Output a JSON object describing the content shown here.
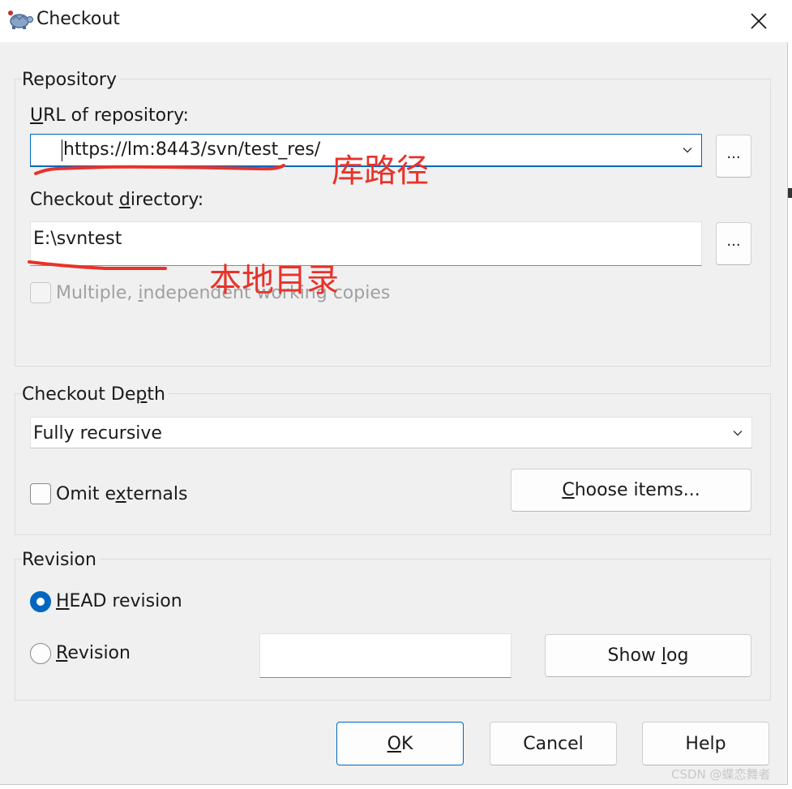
{
  "window": {
    "title": "Checkout",
    "app_icon": "tortoise-icon",
    "close_icon": "close-icon"
  },
  "repository": {
    "group_label": "Repository",
    "url_label_accel": "U",
    "url_label_rest": "RL of repository:",
    "url_value": "https://lm:8443/svn/test_res/",
    "url_browse_label": "...",
    "dir_label_pre": "Checkout ",
    "dir_label_accel": "d",
    "dir_label_post": "irectory:",
    "dir_value": "E:\\svntest",
    "dir_browse_label": "...",
    "multiple_label_pre": "Multiple, ",
    "multiple_label_accel": "i",
    "multiple_label_post": "ndependent working copies",
    "multiple_checked": false,
    "multiple_enabled": false
  },
  "depth": {
    "group_label_pre": "Checkout De",
    "group_label_accel": "p",
    "group_label_post": "th",
    "selected": "Fully recursive",
    "omit_label_pre": "Omit e",
    "omit_label_accel": "x",
    "omit_label_post": "ternals",
    "omit_checked": false,
    "choose_accel": "C",
    "choose_rest": "hoose items..."
  },
  "revision": {
    "group_label": "Revision",
    "head_accel": "H",
    "head_rest": "EAD revision",
    "head_checked": true,
    "rev_accel": "R",
    "rev_rest": "evision",
    "rev_checked": false,
    "rev_value": "",
    "showlog_pre": "Show ",
    "showlog_accel": "l",
    "showlog_post": "og"
  },
  "buttons": {
    "ok_accel": "O",
    "ok_rest": "K",
    "cancel": "Cancel",
    "help": "Help"
  },
  "annotations": {
    "repo_path": "库路径",
    "local_dir": "本地目录",
    "color": "#e8322a"
  },
  "watermark": "CSDN @蝶恋舞者",
  "colors": {
    "accent": "#0067c0",
    "dialog_bg": "#f0f0f0"
  }
}
